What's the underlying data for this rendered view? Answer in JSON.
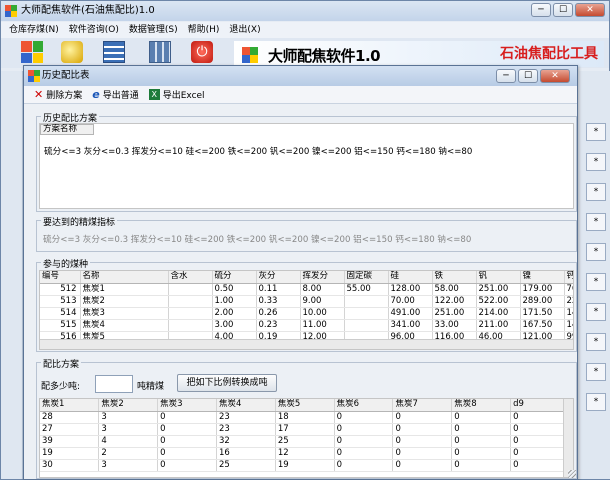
{
  "app": {
    "title": "大师配焦软件(石油焦配比)1.0",
    "menu": [
      "仓库存煤(N)",
      "软件咨询(O)",
      "数据管理(S)",
      "帮助(H)",
      "退出(X)"
    ],
    "banner_title": "大师配焦软件1.0",
    "banner_right": "石油焦配比工具",
    "win_min": "─",
    "win_max": "☐",
    "win_close": "✕"
  },
  "side_buttons": [
    "*",
    "*",
    "*",
    "*",
    "*",
    "*",
    "*",
    "*",
    "*",
    "*"
  ],
  "dialog": {
    "title": "历史配比表",
    "toolbar": {
      "delete": "删除方案",
      "export_normal": "导出普通",
      "export_excel": "导出Excel"
    },
    "history": {
      "group_label": "历史配比方案",
      "col_header": "方案名称",
      "row": "硫分<=3 灰分<=0.3 挥发分<=10 硅<=200 铁<=200 钒<=200 镍<=200 铝<=150 钙<=180 钠<=80"
    },
    "target": {
      "group_label": "要达到的精煤指标",
      "text": "硫分<=3 灰分<=0.3 挥发分<=10 硅<=200 铁<=200 钒<=200 镍<=200 铝<=150 钙<=180 钠<=80"
    },
    "coals": {
      "group_label": "参与的煤种",
      "headers": [
        "编号",
        "名称",
        "含水",
        "硫分",
        "灰分",
        "挥发分",
        "固定碳",
        "硅",
        "铁",
        "钒",
        "镍",
        "钙"
      ],
      "rows": [
        [
          "512",
          "焦炭1",
          "",
          "0.50",
          "0.11",
          "8.00",
          "55.00",
          "128.00",
          "58.00",
          "251.00",
          "179.00",
          "76"
        ],
        [
          "513",
          "焦炭2",
          "",
          "1.00",
          "0.33",
          "9.00",
          "",
          "70.00",
          "122.00",
          "522.00",
          "289.00",
          "22"
        ],
        [
          "514",
          "焦炭3",
          "",
          "2.00",
          "0.26",
          "10.00",
          "",
          "491.00",
          "251.00",
          "214.00",
          "171.50",
          "14"
        ],
        [
          "515",
          "焦炭4",
          "",
          "3.00",
          "0.23",
          "11.00",
          "",
          "341.00",
          "33.00",
          "211.00",
          "167.50",
          "14"
        ],
        [
          "516",
          "焦炭5",
          "",
          "4.00",
          "0.19",
          "12.00",
          "",
          "96.00",
          "116.00",
          "46.00",
          "121.00",
          "99"
        ]
      ]
    },
    "ratio": {
      "group_label": "配比方案",
      "label": "配多少吨:",
      "value": "",
      "unit": "吨精煤",
      "button": "把如下比例转换成吨",
      "headers": [
        "焦炭1",
        "焦炭2",
        "焦炭3",
        "焦炭4",
        "焦炭5",
        "焦炭6",
        "焦炭7",
        "焦炭8",
        "d9"
      ],
      "rows": [
        [
          "28",
          "3",
          "0",
          "23",
          "18",
          "0",
          "0",
          "0",
          "0"
        ],
        [
          "27",
          "3",
          "0",
          "23",
          "17",
          "0",
          "0",
          "0",
          "0"
        ],
        [
          "39",
          "4",
          "0",
          "32",
          "25",
          "0",
          "0",
          "0",
          "0"
        ],
        [
          "19",
          "2",
          "0",
          "16",
          "12",
          "0",
          "0",
          "0",
          "0"
        ],
        [
          "30",
          "3",
          "0",
          "25",
          "19",
          "0",
          "0",
          "0",
          "0"
        ]
      ]
    }
  },
  "colors": {
    "accent": "#d81e1e",
    "title_bar": "#c3d4ea"
  }
}
